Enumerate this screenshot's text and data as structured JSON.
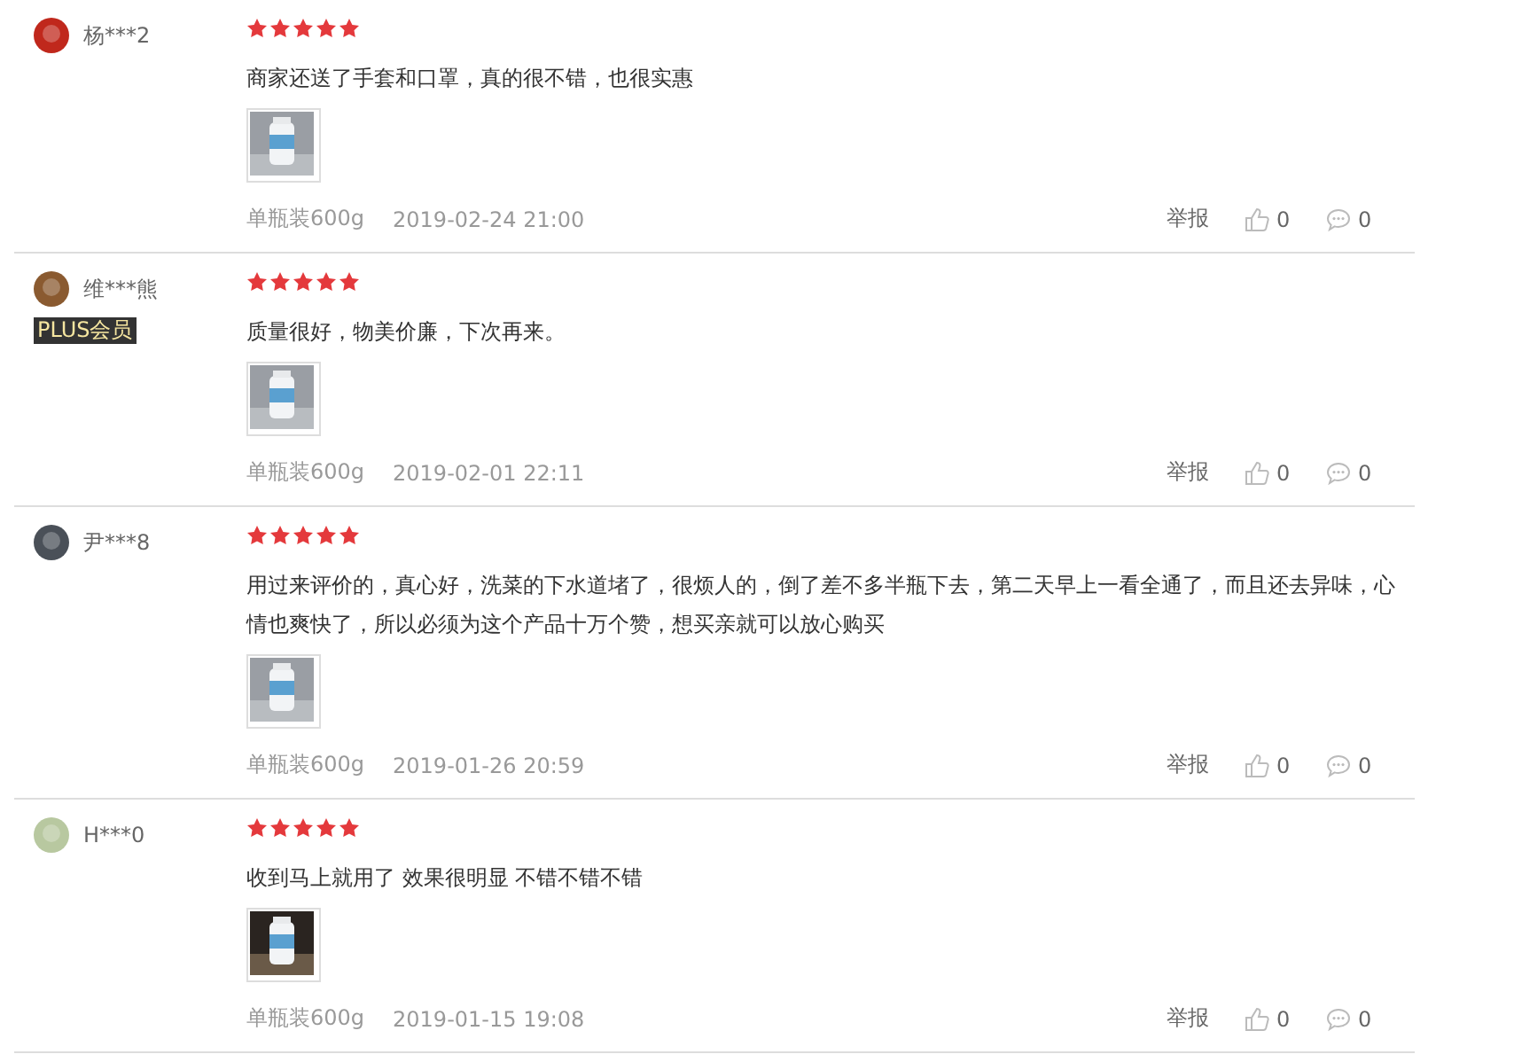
{
  "reviews": [
    {
      "user": "杨***2",
      "stars": 5,
      "text": "商家还送了手套和口罩，真的很不错，也很实惠",
      "variant": "单瓶装600g",
      "time": "2019-02-24 21:00",
      "report": "举报",
      "likes": "0",
      "replies": "0"
    },
    {
      "user": "维***熊",
      "plus_badge": "PLUS会员",
      "stars": 5,
      "text": "质量很好，物美价廉，下次再来。",
      "variant": "单瓶装600g",
      "time": "2019-02-01 22:11",
      "report": "举报",
      "likes": "0",
      "replies": "0"
    },
    {
      "user": "尹***8",
      "stars": 5,
      "text": "用过来评价的，真心好，洗菜的下水道堵了，很烦人的，倒了差不多半瓶下去，第二天早上一看全通了，而且还去异味，心情也爽快了，所以必须为这个产品十万个赞，想买亲就可以放心购买",
      "variant": "单瓶装600g",
      "time": "2019-01-26 20:59",
      "report": "举报",
      "likes": "0",
      "replies": "0"
    },
    {
      "user": "H***0",
      "stars": 5,
      "text": "收到马上就用了 效果很明显 不错不错不错",
      "variant": "单瓶装600g",
      "time": "2019-01-15 19:08",
      "report": "举报",
      "likes": "0",
      "replies": "0"
    }
  ]
}
